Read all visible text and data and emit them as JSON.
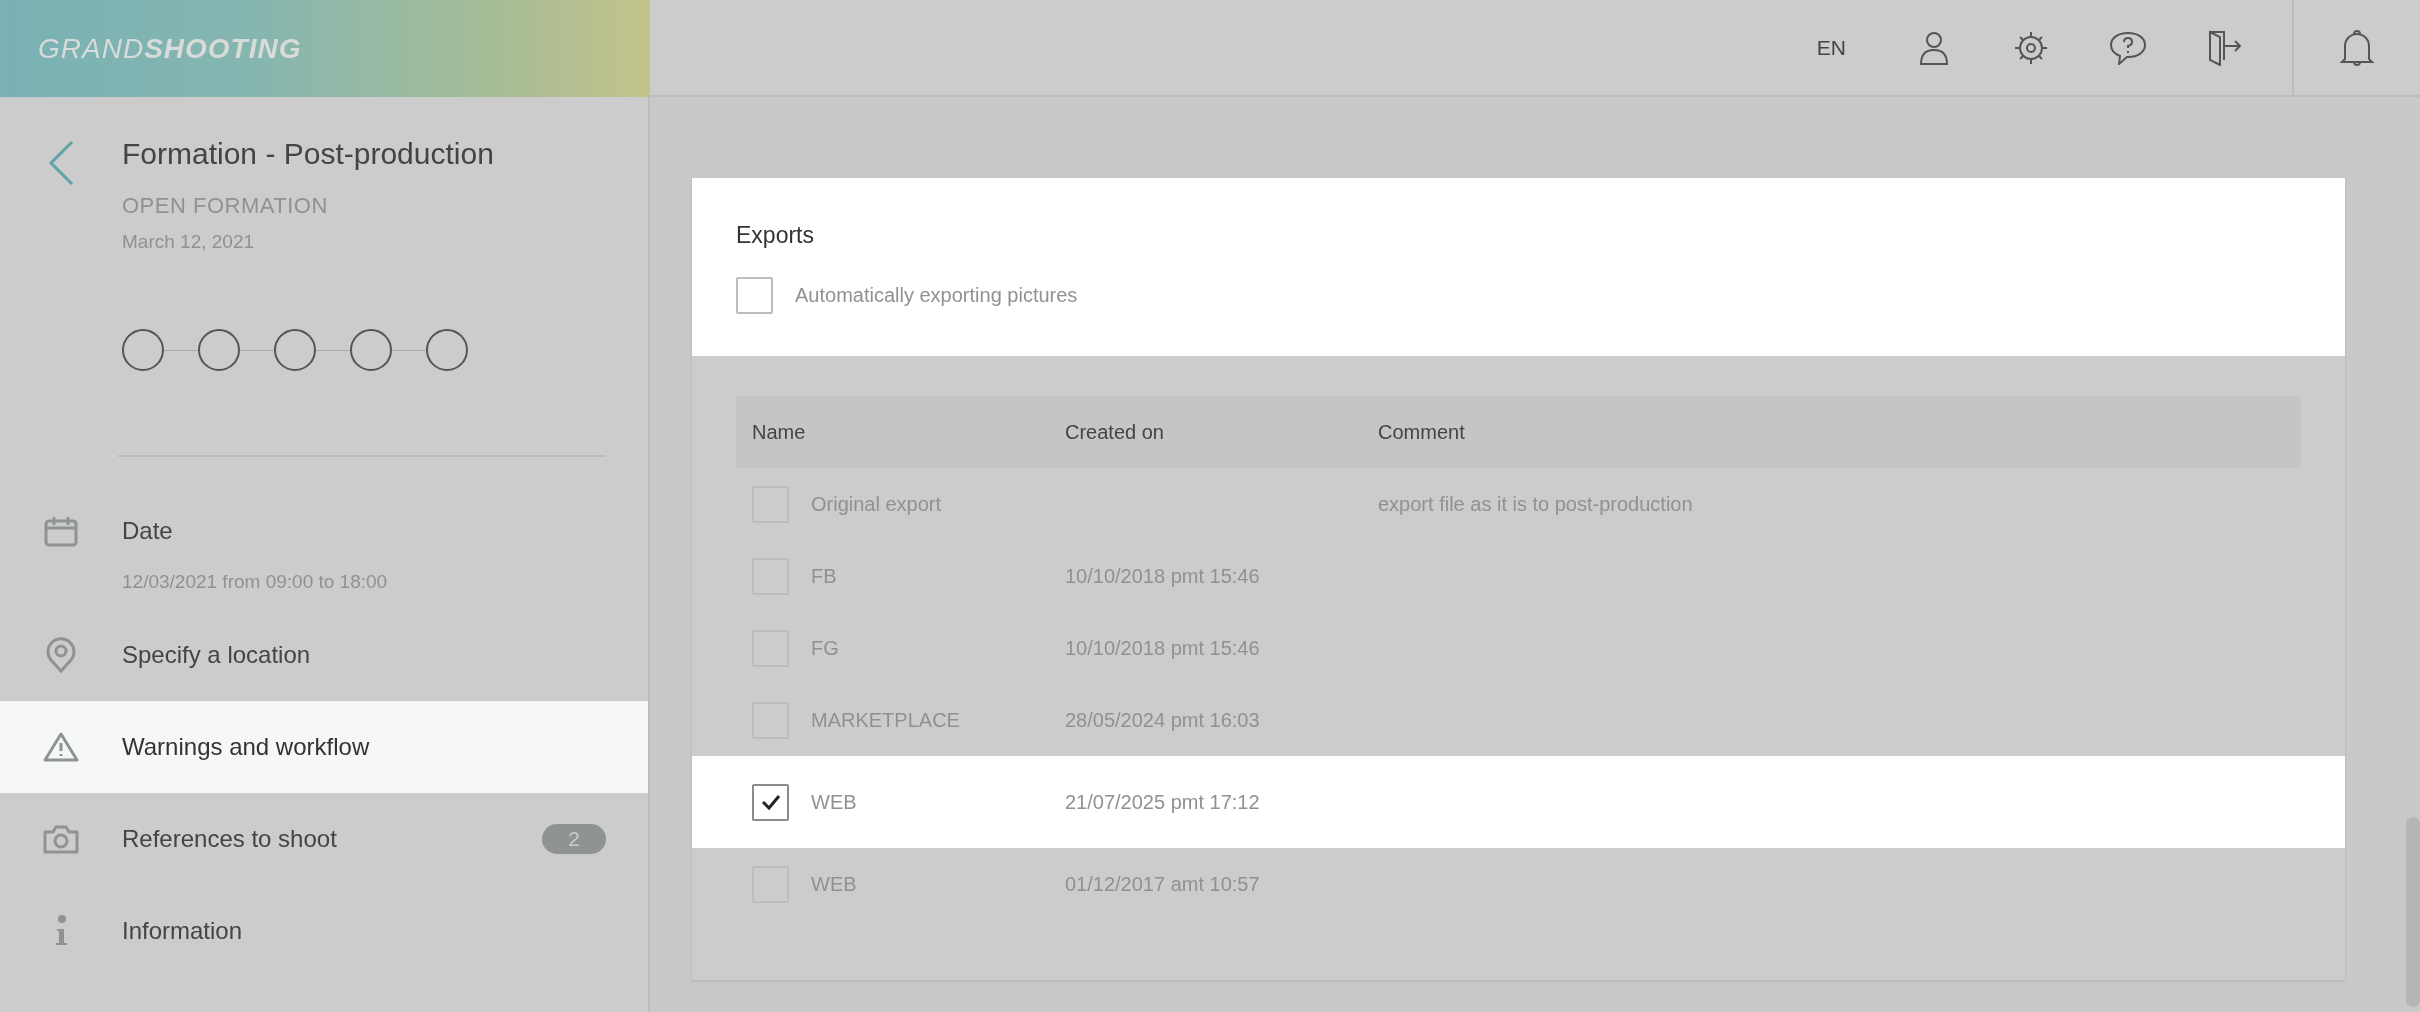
{
  "logo": {
    "light": "GRAND",
    "bold": "SHOOTING"
  },
  "topbar": {
    "language": "EN",
    "buttons": [
      {
        "kind": "user"
      },
      {
        "kind": "settings"
      },
      {
        "kind": "help"
      },
      {
        "kind": "logout"
      }
    ]
  },
  "header": {
    "title": "Formation - Post-production",
    "status": "OPEN FORMATION",
    "date": "March 12, 2021"
  },
  "steps": [
    {
      "done": false
    },
    {
      "done": false
    },
    {
      "done": false
    },
    {
      "done": false
    },
    {
      "done": false
    }
  ],
  "sidebar": {
    "items": [
      {
        "kind": "calendar",
        "label": "Date",
        "detail": "12/03/2021 from 09:00 to 18:00",
        "selected": false
      },
      {
        "kind": "pin",
        "label": "Specify a location",
        "selected": false
      },
      {
        "kind": "warning",
        "label": "Warnings and workflow",
        "selected": true
      },
      {
        "kind": "camera",
        "label": "References to shoot",
        "badge": "2",
        "selected": false
      },
      {
        "kind": "info",
        "label": "Information",
        "selected": false
      }
    ]
  },
  "exports": {
    "title": "Exports",
    "auto_export": {
      "label": "Automatically exporting pictures",
      "checked": false
    }
  },
  "table": {
    "columns": [
      "Name",
      "Created on",
      "Comment"
    ],
    "rows": [
      {
        "name": "Original export",
        "comment": "export file as it is to post-production",
        "checked": false,
        "selected": false
      },
      {
        "name": "FB",
        "created": "10/10/2018 pmt 15:46",
        "checked": false,
        "selected": false
      },
      {
        "name": "FG",
        "created": "10/10/2018 pmt 15:46",
        "checked": false,
        "selected": false
      },
      {
        "name": "MARKETPLACE",
        "created": "28/05/2024 pmt 16:03",
        "checked": false,
        "selected": false
      },
      {
        "name": "WEB",
        "created": "21/07/2025 pmt 17:12",
        "checked": true,
        "selected": true
      },
      {
        "name": "WEB",
        "created": "01/12/2017 amt 10:57",
        "checked": false,
        "selected": false
      }
    ]
  }
}
